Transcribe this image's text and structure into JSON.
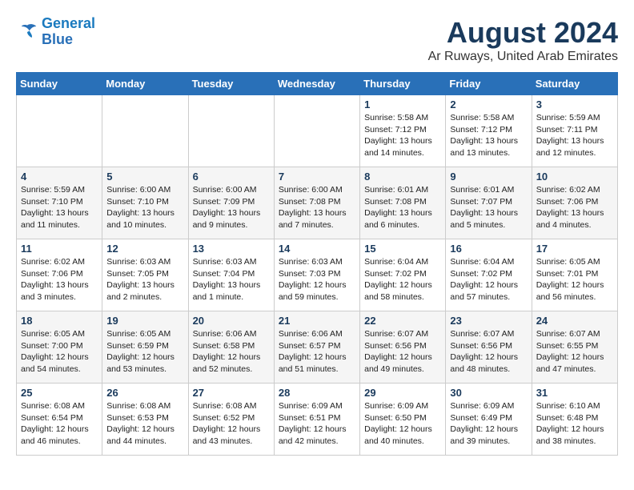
{
  "logo": {
    "line1": "General",
    "line2": "Blue"
  },
  "title": {
    "month_year": "August 2024",
    "location": "Ar Ruways, United Arab Emirates"
  },
  "headers": [
    "Sunday",
    "Monday",
    "Tuesday",
    "Wednesday",
    "Thursday",
    "Friday",
    "Saturday"
  ],
  "weeks": [
    [
      {
        "day": "",
        "info": ""
      },
      {
        "day": "",
        "info": ""
      },
      {
        "day": "",
        "info": ""
      },
      {
        "day": "",
        "info": ""
      },
      {
        "day": "1",
        "info": "Sunrise: 5:58 AM\nSunset: 7:12 PM\nDaylight: 13 hours\nand 14 minutes."
      },
      {
        "day": "2",
        "info": "Sunrise: 5:58 AM\nSunset: 7:12 PM\nDaylight: 13 hours\nand 13 minutes."
      },
      {
        "day": "3",
        "info": "Sunrise: 5:59 AM\nSunset: 7:11 PM\nDaylight: 13 hours\nand 12 minutes."
      }
    ],
    [
      {
        "day": "4",
        "info": "Sunrise: 5:59 AM\nSunset: 7:10 PM\nDaylight: 13 hours\nand 11 minutes."
      },
      {
        "day": "5",
        "info": "Sunrise: 6:00 AM\nSunset: 7:10 PM\nDaylight: 13 hours\nand 10 minutes."
      },
      {
        "day": "6",
        "info": "Sunrise: 6:00 AM\nSunset: 7:09 PM\nDaylight: 13 hours\nand 9 minutes."
      },
      {
        "day": "7",
        "info": "Sunrise: 6:00 AM\nSunset: 7:08 PM\nDaylight: 13 hours\nand 7 minutes."
      },
      {
        "day": "8",
        "info": "Sunrise: 6:01 AM\nSunset: 7:08 PM\nDaylight: 13 hours\nand 6 minutes."
      },
      {
        "day": "9",
        "info": "Sunrise: 6:01 AM\nSunset: 7:07 PM\nDaylight: 13 hours\nand 5 minutes."
      },
      {
        "day": "10",
        "info": "Sunrise: 6:02 AM\nSunset: 7:06 PM\nDaylight: 13 hours\nand 4 minutes."
      }
    ],
    [
      {
        "day": "11",
        "info": "Sunrise: 6:02 AM\nSunset: 7:06 PM\nDaylight: 13 hours\nand 3 minutes."
      },
      {
        "day": "12",
        "info": "Sunrise: 6:03 AM\nSunset: 7:05 PM\nDaylight: 13 hours\nand 2 minutes."
      },
      {
        "day": "13",
        "info": "Sunrise: 6:03 AM\nSunset: 7:04 PM\nDaylight: 13 hours\nand 1 minute."
      },
      {
        "day": "14",
        "info": "Sunrise: 6:03 AM\nSunset: 7:03 PM\nDaylight: 12 hours\nand 59 minutes."
      },
      {
        "day": "15",
        "info": "Sunrise: 6:04 AM\nSunset: 7:02 PM\nDaylight: 12 hours\nand 58 minutes."
      },
      {
        "day": "16",
        "info": "Sunrise: 6:04 AM\nSunset: 7:02 PM\nDaylight: 12 hours\nand 57 minutes."
      },
      {
        "day": "17",
        "info": "Sunrise: 6:05 AM\nSunset: 7:01 PM\nDaylight: 12 hours\nand 56 minutes."
      }
    ],
    [
      {
        "day": "18",
        "info": "Sunrise: 6:05 AM\nSunset: 7:00 PM\nDaylight: 12 hours\nand 54 minutes."
      },
      {
        "day": "19",
        "info": "Sunrise: 6:05 AM\nSunset: 6:59 PM\nDaylight: 12 hours\nand 53 minutes."
      },
      {
        "day": "20",
        "info": "Sunrise: 6:06 AM\nSunset: 6:58 PM\nDaylight: 12 hours\nand 52 minutes."
      },
      {
        "day": "21",
        "info": "Sunrise: 6:06 AM\nSunset: 6:57 PM\nDaylight: 12 hours\nand 51 minutes."
      },
      {
        "day": "22",
        "info": "Sunrise: 6:07 AM\nSunset: 6:56 PM\nDaylight: 12 hours\nand 49 minutes."
      },
      {
        "day": "23",
        "info": "Sunrise: 6:07 AM\nSunset: 6:56 PM\nDaylight: 12 hours\nand 48 minutes."
      },
      {
        "day": "24",
        "info": "Sunrise: 6:07 AM\nSunset: 6:55 PM\nDaylight: 12 hours\nand 47 minutes."
      }
    ],
    [
      {
        "day": "25",
        "info": "Sunrise: 6:08 AM\nSunset: 6:54 PM\nDaylight: 12 hours\nand 46 minutes."
      },
      {
        "day": "26",
        "info": "Sunrise: 6:08 AM\nSunset: 6:53 PM\nDaylight: 12 hours\nand 44 minutes."
      },
      {
        "day": "27",
        "info": "Sunrise: 6:08 AM\nSunset: 6:52 PM\nDaylight: 12 hours\nand 43 minutes."
      },
      {
        "day": "28",
        "info": "Sunrise: 6:09 AM\nSunset: 6:51 PM\nDaylight: 12 hours\nand 42 minutes."
      },
      {
        "day": "29",
        "info": "Sunrise: 6:09 AM\nSunset: 6:50 PM\nDaylight: 12 hours\nand 40 minutes."
      },
      {
        "day": "30",
        "info": "Sunrise: 6:09 AM\nSunset: 6:49 PM\nDaylight: 12 hours\nand 39 minutes."
      },
      {
        "day": "31",
        "info": "Sunrise: 6:10 AM\nSunset: 6:48 PM\nDaylight: 12 hours\nand 38 minutes."
      }
    ]
  ]
}
